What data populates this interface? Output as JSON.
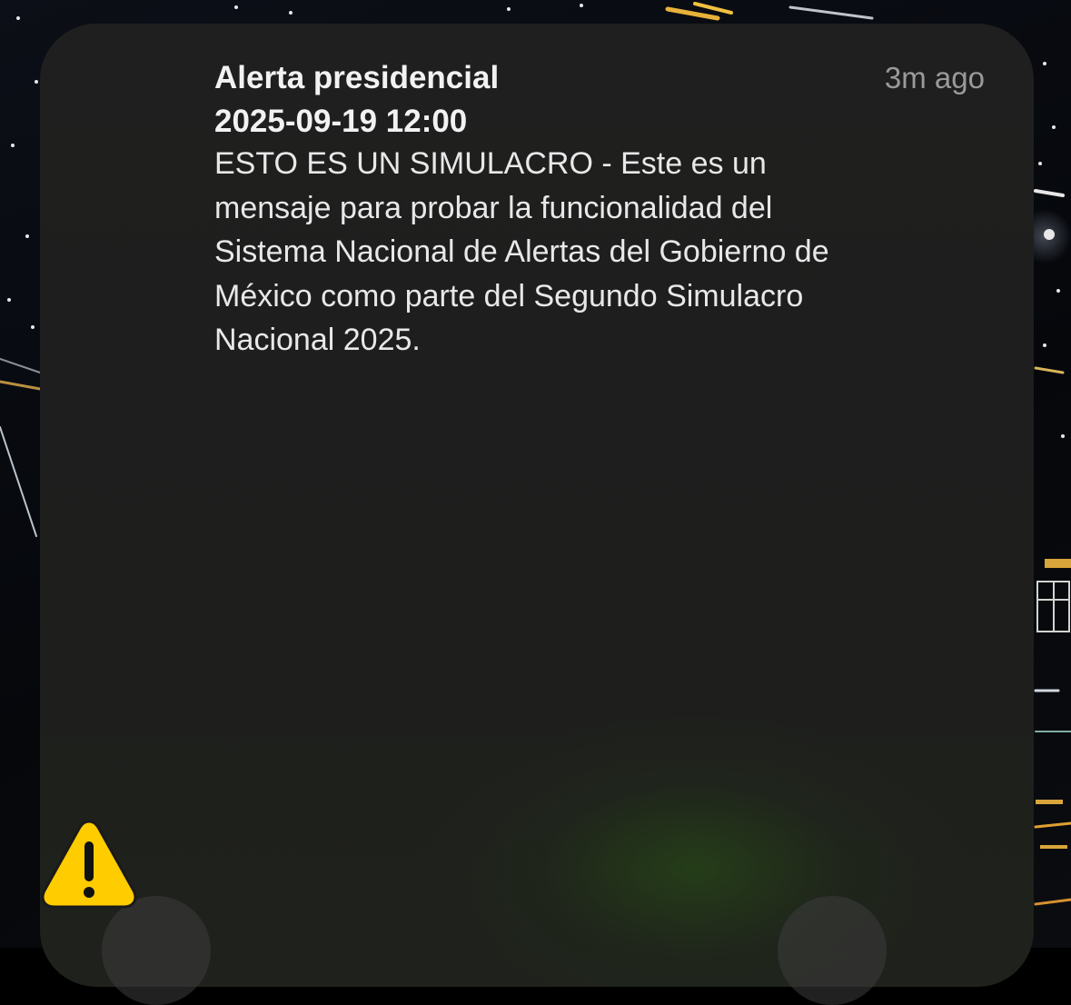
{
  "alert": {
    "title": "Alerta presidencial",
    "datetime": "2025-09-19 12:00",
    "time_ago": "3m ago",
    "body_lines": [
      "ESTO ES UN SIMULACRO - Este es un",
      "mensaje para probar la funcionalidad del",
      "Sistema Nacional de Alertas del Gobierno de",
      "México como parte del Segundo Simulacro",
      "Nacional 2025."
    ],
    "icon": "warning-icon"
  },
  "colors": {
    "card_background": "#1f1f1f",
    "title_text": "#f2f2f2",
    "body_text": "#e8e8e8",
    "time_text": "#9a9a9a",
    "warning_yellow": "#ffcc00"
  }
}
